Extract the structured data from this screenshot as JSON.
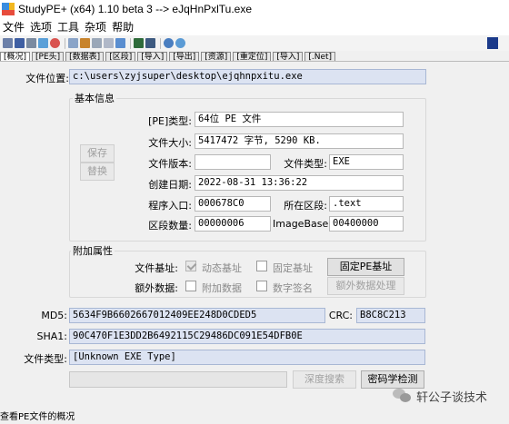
{
  "window": {
    "title": "StudyPE+ (x64) 1.10 beta 3  --> eJqHnPxlTu.exe"
  },
  "menu": [
    "文件",
    "选项",
    "工具",
    "杂项",
    "帮助"
  ],
  "tabs": [
    "[概况]",
    "[PE头]",
    "[数据表]",
    "[区段]",
    "[导入]",
    "[导出]",
    "[资源]",
    "[重定位]",
    "[导入]",
    "[.Net]"
  ],
  "file_location": {
    "label": "文件位置:",
    "value": "c:\\users\\zyjsuper\\desktop\\ejqhnpxitu.exe"
  },
  "basic_info": {
    "title": "基本信息",
    "save_button": "保存",
    "replace_button": "替换",
    "pe_type_label": "[PE]类型:",
    "pe_type": "64位 PE 文件",
    "file_size_label": "文件大小:",
    "file_size": "5417472 字节, 5290 KB.",
    "file_version_label": "文件版本:",
    "file_version": "",
    "file_type_label": "文件类型:",
    "file_type": "EXE",
    "created_label": "创建日期:",
    "created": "2022-08-31 13:36:22",
    "entry_label": "程序入口:",
    "entry": "000678C0",
    "section_label": "所在区段:",
    "section": ".text",
    "section_count_label": "区段数量:",
    "section_count": "00000006",
    "imagebase_label": "ImageBase:",
    "imagebase": "00400000"
  },
  "extra": {
    "title": "附加属性",
    "file_base_label": "文件基址:",
    "dynamic_base": "动态基址",
    "fixed_base": "固定基址",
    "fixed_pe_button": "固定PE基址",
    "extra_data_label": "额外数据:",
    "append_data": "附加数据",
    "digital_sign": "数字签名",
    "extra_process_button": "额外数据处理"
  },
  "hashes": {
    "md5_label": "MD5:",
    "md5": "5634F9B6602667012409EE248D0CDED5",
    "crc_label": "CRC:",
    "crc": "B8C8C213",
    "sha1_label": "SHA1:",
    "sha1": "90C470F1E3DD2B6492115C29486DC091E54DFB0E",
    "filetype_label": "文件类型:",
    "filetype": "[Unknown EXE Type]"
  },
  "bottom": {
    "deep_search_button": "深度搜索",
    "crypto_button": "密码学检测"
  },
  "watermark": "轩公子谈技术",
  "status": "查看PE文件的概况"
}
